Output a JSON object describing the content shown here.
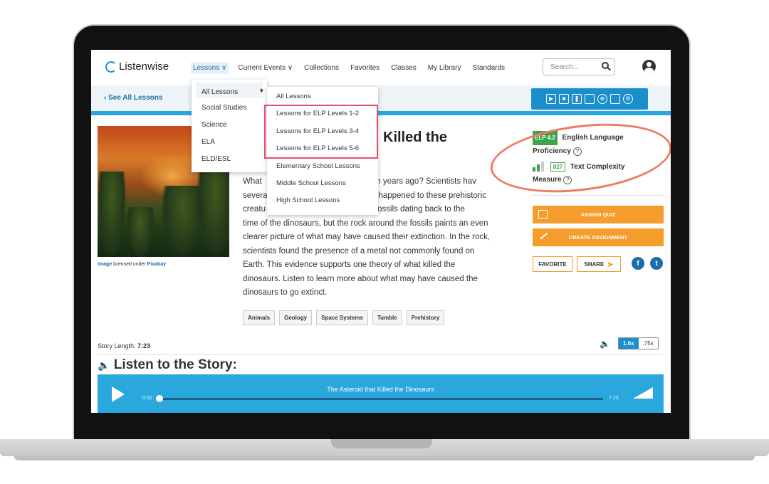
{
  "logo": {
    "text": "Listenwise"
  },
  "nav": {
    "items": [
      "Lessons ∨",
      "Current Events ∨",
      "Collections",
      "Favorites",
      "Classes",
      "My Library",
      "Standards"
    ]
  },
  "search": {
    "placeholder": "Search..."
  },
  "subheader": {
    "back_label": "‹  See All Lessons"
  },
  "lessons_menu": {
    "items": [
      "All Lessons",
      "Social Studies",
      "Science",
      "ELA",
      "ELD/ESL"
    ]
  },
  "all_lessons_submenu": {
    "items": [
      "All Lessons",
      "Lessons for ELP Levels 1-2",
      "Lessons for ELP Levels 3-4",
      "Lessons for ELP Levels 5-6",
      "Elementary School Lessons",
      "Middle School Lessons",
      "High School Lessons"
    ]
  },
  "story": {
    "title_visible": "Killed the",
    "body_lines": [
      "What                                          million years ago? Scientists hav",
      "severa                                        have happened to these prehistoric",
      "creatu                                        from fossils dating back to the",
      "time of the dinosaurs, but the rock around the fossils paints an even",
      "clearer picture of what may have caused their extinction. In the rock,",
      "scientists found the presence of a metal not commonly found on",
      "Earth. This evidence supports one theory of what killed the",
      "dinosaurs. Listen to learn more about what may have caused the",
      "dinosaurs to go extinct."
    ],
    "tags": [
      "Animals",
      "Geology",
      "Space Systems",
      "Tumble",
      "Prehistory"
    ],
    "image_credit": {
      "link1": "Image",
      "middle": " licensed under ",
      "link2": "Pixabay"
    }
  },
  "panel": {
    "elp_badge": "ELP 4.2",
    "elp_label_1": "English Language",
    "elp_label_2": "Proficiency",
    "lexile": "827",
    "complexity_label_1": "Text Complexity",
    "complexity_label_2": "Measure",
    "help": "?",
    "assign_quiz": "ASSIGN QUIZ",
    "create_assignment": "CREATE ASSIGNMENT",
    "favorite": "FAVORITE",
    "share": "SHARE",
    "facebook": "f",
    "twitter": "t"
  },
  "audio": {
    "story_length_label": "Story Length: ",
    "story_length_value": "7:23",
    "speed_options": [
      "1.0x",
      ".75x"
    ],
    "heading": "Listen to the Story:",
    "track_title": "The Asteroid that Killed the Dinosaurs",
    "time_start": "0:00",
    "time_end": "7:23",
    "progress": 0
  },
  "colors": {
    "brand_blue": "#1b8fcb",
    "accent_orange": "#f59c2a",
    "elp_green": "#3fa34d",
    "annotation_red": "#ef7b62",
    "highlight_pink": "#e0526e"
  }
}
